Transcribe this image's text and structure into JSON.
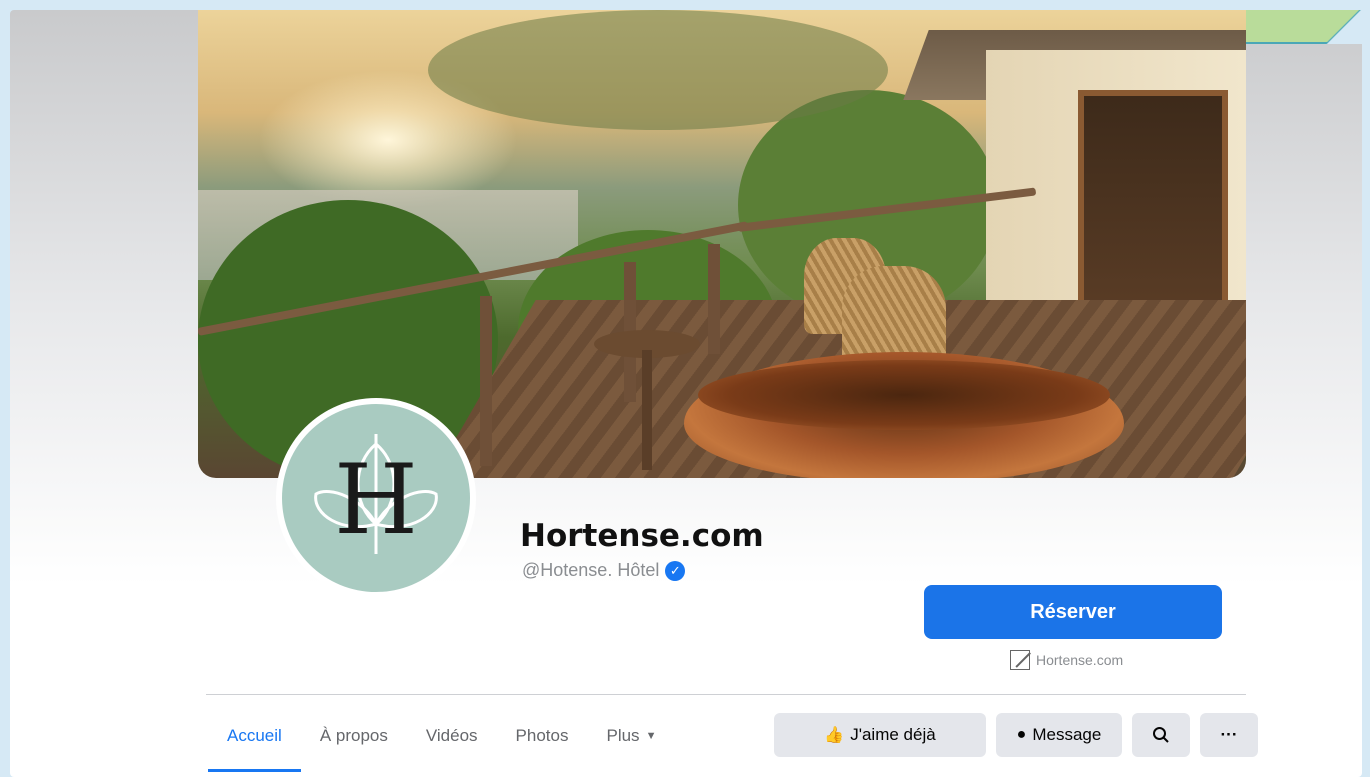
{
  "page": {
    "name": "Hortense.com",
    "handle": "@Hotense. Hôtel",
    "avatar_letter": "H",
    "cta_label": "Réserver",
    "website": "Hortense.com"
  },
  "tabs": [
    {
      "label": "Accueil",
      "active": true
    },
    {
      "label": "À propos"
    },
    {
      "label": "Vidéos"
    },
    {
      "label": "Photos"
    },
    {
      "label": "Plus"
    }
  ],
  "actions": {
    "like": "J'aime déjà",
    "message": "Message"
  },
  "icons": {
    "like": "thumbs-up-icon",
    "message": "messenger-icon",
    "search": "search-icon",
    "more": "more-icon",
    "verified": "verified-badge-icon",
    "external": "external-link-icon"
  },
  "colors": {
    "accent": "#1877f2",
    "cta": "#1b74e8",
    "button_bg": "#e4e6eb"
  }
}
